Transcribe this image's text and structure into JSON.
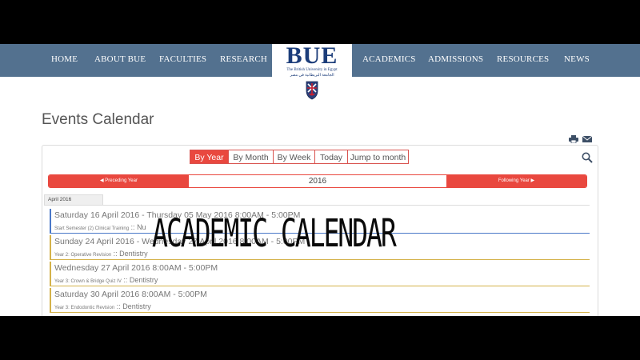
{
  "nav": {
    "items": [
      "HOME",
      "ABOUT BUE",
      "FACULTIES",
      "RESEARCH",
      "ACADEMICS",
      "ADMISSIONS",
      "RESOURCES",
      "NEWS"
    ],
    "logo": {
      "text": "BUE",
      "subtitle": "The British University in Egypt",
      "subtitle_ar": "الجامعة البريطانية في مصر"
    }
  },
  "page": {
    "title": "Events Calendar"
  },
  "toolbar": {
    "views": [
      "By Year",
      "By Month",
      "By Week",
      "Today",
      "Jump to month"
    ],
    "active_view": "By Year"
  },
  "yearbar": {
    "prev": "Preceding Year",
    "year": "2016",
    "next": "Following Year"
  },
  "month_tab": "April 2016",
  "events": [
    {
      "date": "Saturday 16 April 2016 - Thursday 05 May 2016 8:00AM - 5:00PM",
      "detail": "Start Semester (2) Clinical Training",
      "category": "Nu",
      "color": "#4a78c8"
    },
    {
      "date": "Sunday 24 April 2016 - Wednesday 27 April 2016 8:00AM - 5:00PM",
      "detail": "Year 2: Operative Revision",
      "category": "Dentistry",
      "color": "#d4b24a"
    },
    {
      "date": "Wednesday 27 April 2016 8:00AM - 5:00PM",
      "detail": "Year 3: Crown & Bridge Quiz IV",
      "category": "Dentistry",
      "color": "#d4b24a"
    },
    {
      "date": "Saturday 30 April 2016 8:00AM - 5:00PM",
      "detail": "Year 3: Endodontic Revision",
      "category": "Dentistry",
      "color": "#d4b24a"
    }
  ],
  "overlay": {
    "title": "ACADEMIC CALENDAR"
  }
}
